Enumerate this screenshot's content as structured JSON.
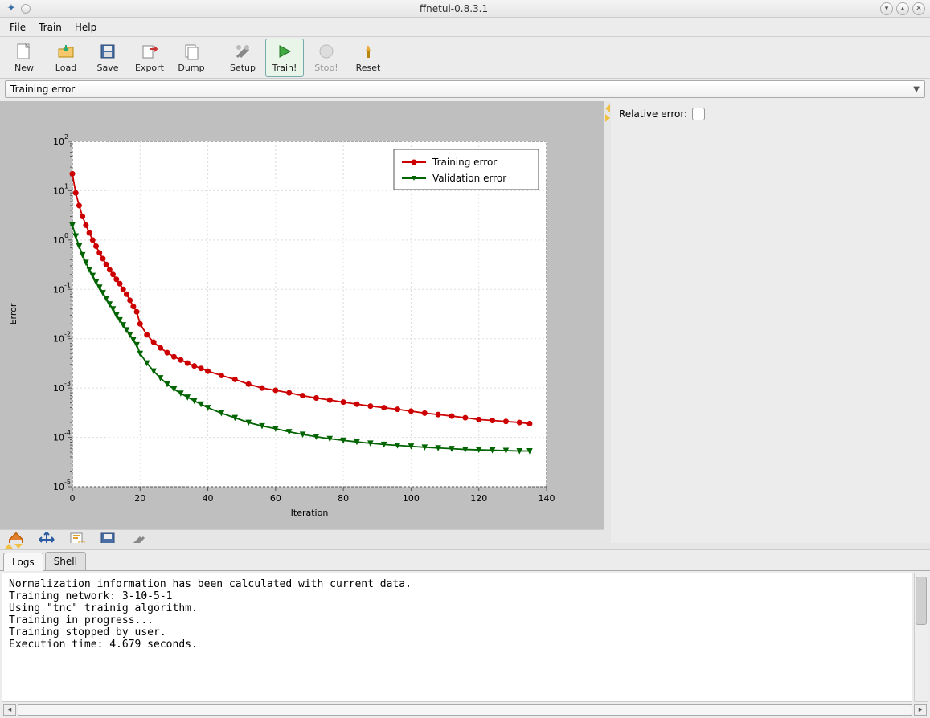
{
  "window": {
    "title": "ffnetui-0.8.3.1"
  },
  "menu": {
    "items": [
      "File",
      "Train",
      "Help"
    ]
  },
  "toolbar": {
    "new": "New",
    "load": "Load",
    "save": "Save",
    "export": "Export",
    "dump": "Dump",
    "setup": "Setup",
    "train": "Train!",
    "stop": "Stop!",
    "reset": "Reset"
  },
  "combo": {
    "selected": "Training error"
  },
  "right_panel": {
    "relative_error_label": "Relative error:"
  },
  "tabs": {
    "logs": "Logs",
    "shell": "Shell"
  },
  "log_lines": [
    "Normalization information has been calculated with current data.",
    "Training network: 3-10-5-1",
    "Using \"tnc\" trainig algorithm.",
    "Training in progress...",
    "Training stopped by user.",
    "Execution time: 4.679 seconds."
  ],
  "chart_data": {
    "type": "line",
    "title": "",
    "xlabel": "Iteration",
    "ylabel": "Error",
    "xlim": [
      0,
      140
    ],
    "ylim_log10": [
      -5,
      2
    ],
    "xticks": [
      0,
      20,
      40,
      60,
      80,
      100,
      120,
      140
    ],
    "yticks_exp": [
      -5,
      -4,
      -3,
      -2,
      -1,
      0,
      1,
      2
    ],
    "legend": [
      "Training error",
      "Validation error"
    ],
    "colors": {
      "training": "#cc0000",
      "validation": "#006400"
    },
    "x": [
      0,
      1,
      2,
      3,
      4,
      5,
      6,
      7,
      8,
      9,
      10,
      11,
      12,
      13,
      14,
      15,
      16,
      17,
      18,
      19,
      20,
      22,
      24,
      26,
      28,
      30,
      32,
      34,
      36,
      38,
      40,
      44,
      48,
      52,
      56,
      60,
      64,
      68,
      72,
      76,
      80,
      84,
      88,
      92,
      96,
      100,
      104,
      108,
      112,
      116,
      120,
      124,
      128,
      132,
      135
    ],
    "series": [
      {
        "name": "Training error",
        "values": [
          22,
          9,
          5,
          3,
          2,
          1.4,
          1.0,
          0.75,
          0.55,
          0.42,
          0.32,
          0.25,
          0.2,
          0.16,
          0.13,
          0.1,
          0.08,
          0.06,
          0.045,
          0.035,
          0.02,
          0.012,
          0.0085,
          0.0065,
          0.0052,
          0.0043,
          0.0037,
          0.0032,
          0.0028,
          0.0025,
          0.0022,
          0.0018,
          0.0015,
          0.0012,
          0.001,
          0.0009,
          0.0008,
          0.0007,
          0.00063,
          0.00057,
          0.00052,
          0.00047,
          0.00043,
          0.0004,
          0.00037,
          0.00034,
          0.00031,
          0.00029,
          0.00027,
          0.00025,
          0.00023,
          0.00022,
          0.00021,
          0.0002,
          0.00019
        ]
      },
      {
        "name": "Validation error",
        "values": [
          2.0,
          1.2,
          0.75,
          0.5,
          0.35,
          0.25,
          0.19,
          0.14,
          0.11,
          0.085,
          0.065,
          0.05,
          0.04,
          0.03,
          0.024,
          0.019,
          0.015,
          0.012,
          0.0095,
          0.0075,
          0.005,
          0.0032,
          0.0022,
          0.0016,
          0.0012,
          0.00095,
          0.00078,
          0.00065,
          0.00055,
          0.00047,
          0.0004,
          0.00031,
          0.00025,
          0.0002,
          0.00017,
          0.00015,
          0.00013,
          0.000115,
          0.000103,
          9.4e-05,
          8.7e-05,
          8.1e-05,
          7.6e-05,
          7.2e-05,
          6.9e-05,
          6.6e-05,
          6.3e-05,
          6.1e-05,
          5.9e-05,
          5.7e-05,
          5.6e-05,
          5.5e-05,
          5.4e-05,
          5.3e-05,
          5.3e-05
        ]
      }
    ]
  }
}
